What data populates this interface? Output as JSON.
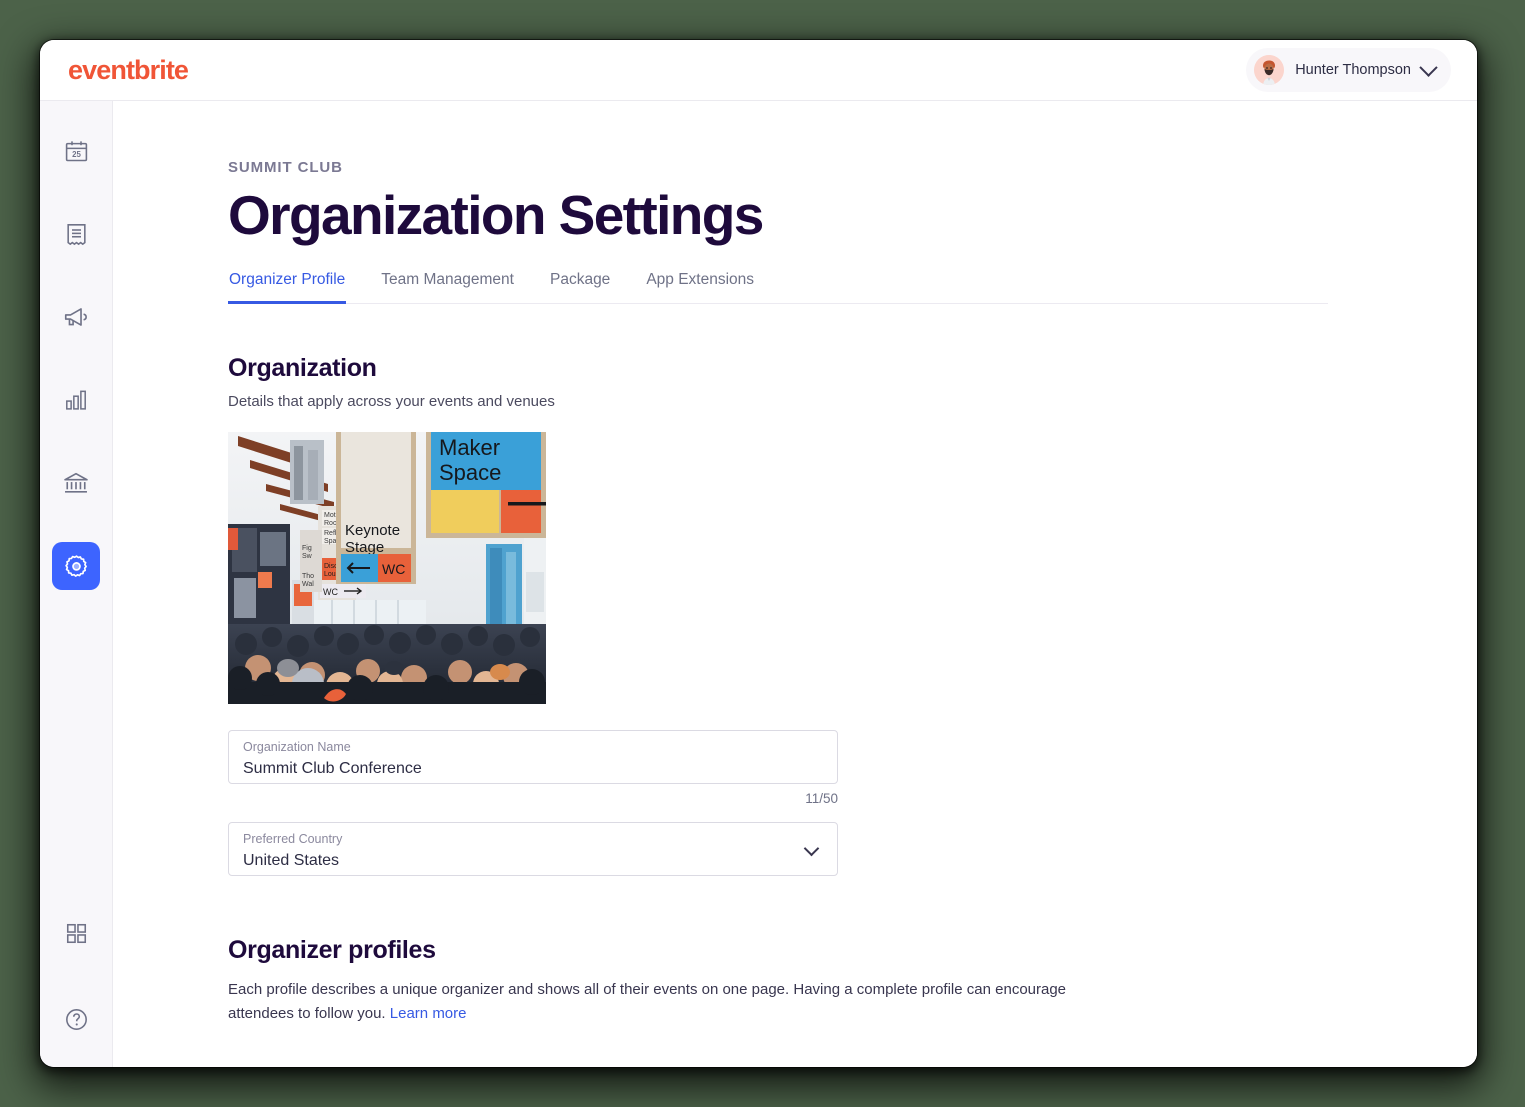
{
  "header": {
    "brand": "eventbrite",
    "brand_color": "#f05537",
    "user_name": "Hunter Thompson",
    "avatar_icon": "user-avatar",
    "chevron_icon": "chevron-down-icon"
  },
  "sidebar": {
    "items": [
      {
        "name": "events",
        "icon": "calendar-icon",
        "day_label": "25",
        "active": false
      },
      {
        "name": "orders",
        "icon": "receipt-icon",
        "active": false
      },
      {
        "name": "marketing",
        "icon": "megaphone-icon",
        "active": false
      },
      {
        "name": "reports",
        "icon": "bar-chart-icon",
        "active": false
      },
      {
        "name": "finance",
        "icon": "bank-icon",
        "active": false
      },
      {
        "name": "settings",
        "icon": "gear-icon",
        "active": true
      }
    ],
    "bottom_items": [
      {
        "name": "apps",
        "icon": "grid-apps-icon"
      },
      {
        "name": "help",
        "icon": "question-circle-icon"
      }
    ],
    "active_color": "#3d64ff"
  },
  "page": {
    "eyebrow": "SUMMIT CLUB",
    "title": "Organization Settings"
  },
  "tabs": [
    {
      "label": "Organizer Profile",
      "active": true
    },
    {
      "label": "Team Management",
      "active": false
    },
    {
      "label": "Package",
      "active": false
    },
    {
      "label": "App Extensions",
      "active": false
    }
  ],
  "tab_active_color": "#3659e3",
  "organization": {
    "heading": "Organization",
    "subheading": "Details that apply across your events and venues",
    "image_alt": "conference-hall-photo",
    "image_signs": [
      "Maker Space",
      "Keynote Stage",
      "WC",
      "WC"
    ],
    "name_field": {
      "label": "Organization Name",
      "value": "Summit Club Conference",
      "placeholder": "Organization Name",
      "char_count": "11/50"
    },
    "country_field": {
      "label": "Preferred Country",
      "value": "United States",
      "chevron_icon": "chevron-down-icon"
    }
  },
  "organizer_profiles": {
    "heading": "Organizer profiles",
    "description": "Each profile describes a unique organizer and shows all of their events on one page. Having a complete profile can encourage attendees to follow you. ",
    "link_label": "Learn more"
  }
}
